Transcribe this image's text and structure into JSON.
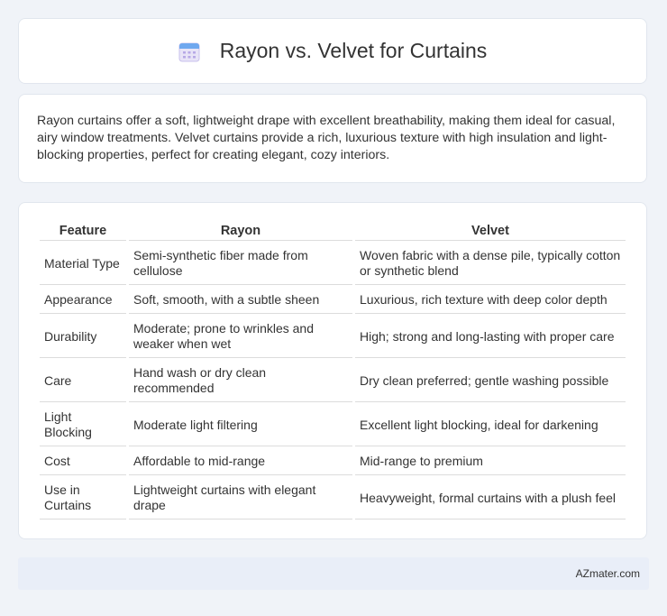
{
  "header": {
    "title": "Rayon vs. Velvet for Curtains",
    "icon": "calendar-icon"
  },
  "intro": "Rayon curtains offer a soft, lightweight drape with excellent breathability, making them ideal for casual, airy window treatments. Velvet curtains provide a rich, luxurious texture with high insulation and light-blocking properties, perfect for creating elegant, cozy interiors.",
  "table": {
    "headers": [
      "Feature",
      "Rayon",
      "Velvet"
    ],
    "rows": [
      [
        "Material Type",
        "Semi-synthetic fiber made from cellulose",
        "Woven fabric with a dense pile, typically cotton or synthetic blend"
      ],
      [
        "Appearance",
        "Soft, smooth, with a subtle sheen",
        "Luxurious, rich texture with deep color depth"
      ],
      [
        "Durability",
        "Moderate; prone to wrinkles and weaker when wet",
        "High; strong and long-lasting with proper care"
      ],
      [
        "Care",
        "Hand wash or dry clean recommended",
        "Dry clean preferred; gentle washing possible"
      ],
      [
        "Light Blocking",
        "Moderate light filtering",
        "Excellent light blocking, ideal for darkening"
      ],
      [
        "Cost",
        "Affordable to mid-range",
        "Mid-range to premium"
      ],
      [
        "Use in Curtains",
        "Lightweight curtains with elegant drape",
        "Heavyweight, formal curtains with a plush feel"
      ]
    ]
  },
  "footer": {
    "brand": "AZmater.com"
  }
}
